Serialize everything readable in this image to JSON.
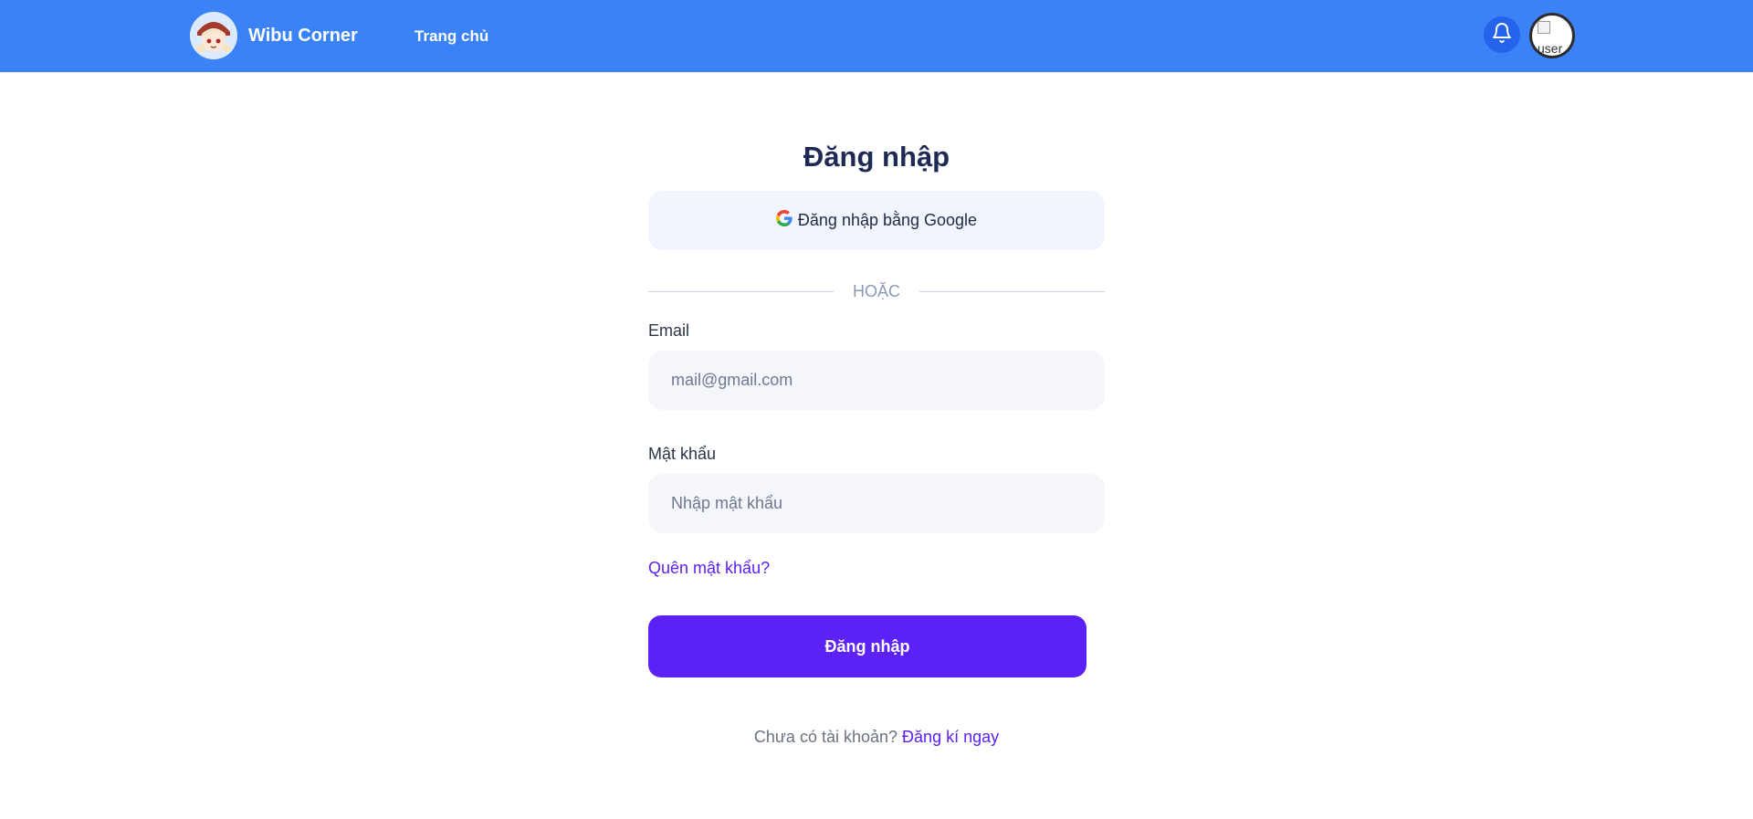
{
  "header": {
    "brand_name": "Wibu Corner",
    "nav_home": "Trang chủ",
    "avatar_alt": "user"
  },
  "login": {
    "title": "Đăng nhập",
    "google_button": "Đăng nhập bằng Google",
    "divider_text": "HOẶC",
    "email_label": "Email",
    "email_placeholder": "mail@gmail.com",
    "email_value": "",
    "password_label": "Mật khẩu",
    "password_placeholder": "Nhập mật khẩu",
    "password_value": "",
    "forgot_link": "Quên mật khẩu?",
    "submit_button": "Đăng nhập",
    "no_account_text": "Chưa có tài khoản?",
    "signup_link": "Đăng kí ngay"
  },
  "colors": {
    "header_bg": "#3b82f6",
    "accent": "#5b21f5",
    "title": "#1e2a55"
  },
  "icons": {
    "logo": "anime-avatar-logo",
    "bell": "bell-icon",
    "google": "google-icon"
  }
}
